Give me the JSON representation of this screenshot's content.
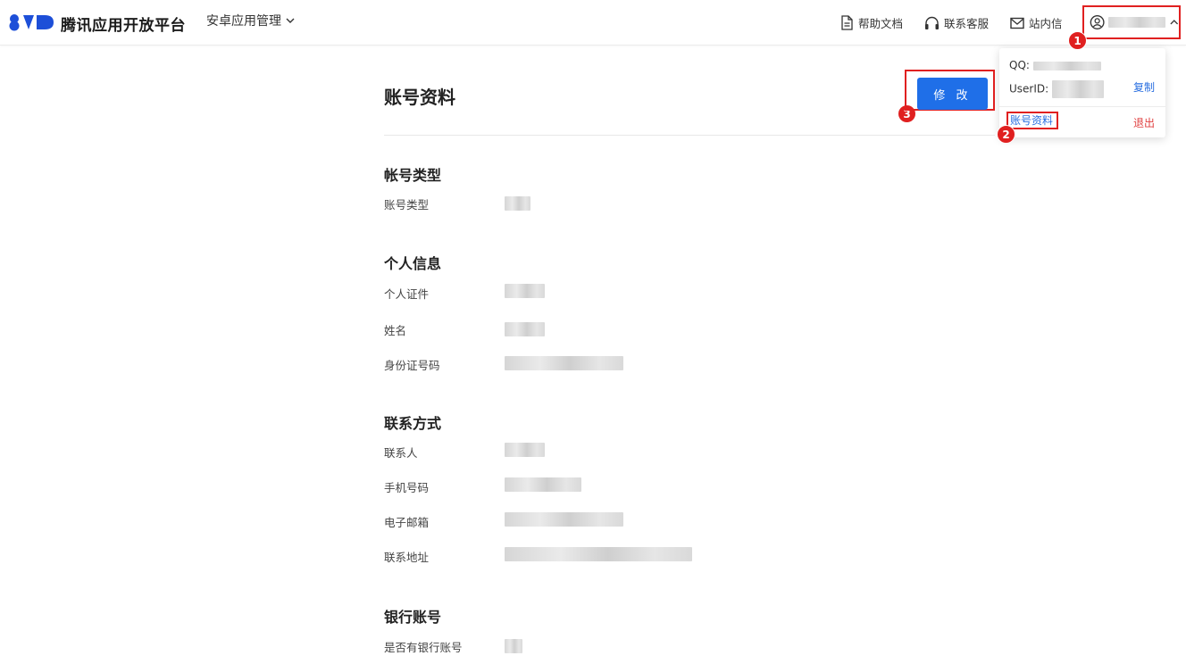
{
  "header": {
    "brand": "腾讯应用开放平台",
    "app_menu": "安卓应用管理",
    "help_docs": "帮助文档",
    "support": "联系客服",
    "inbox": "站内信"
  },
  "dropdown": {
    "qq_label": "QQ:",
    "userid_label": "UserID:",
    "copy": "复制",
    "profile": "账号资料",
    "logout": "退出"
  },
  "markers": [
    "1",
    "2",
    "3"
  ],
  "page": {
    "title": "账号资料",
    "edit_button": "修 改"
  },
  "sections": {
    "account_type": {
      "title": "帐号类型",
      "fields": [
        "账号类型"
      ]
    },
    "personal": {
      "title": "个人信息",
      "fields": [
        "个人证件",
        "姓名",
        "身份证号码"
      ]
    },
    "contact": {
      "title": "联系方式",
      "fields": [
        "联系人",
        "手机号码",
        "电子邮箱",
        "联系地址"
      ]
    },
    "bank": {
      "title": "银行账号",
      "fields": [
        "是否有银行账号"
      ]
    }
  },
  "colors": {
    "accent": "#1f6fe8",
    "annotation_red": "#e02020",
    "link": "#2a6fe0",
    "logout": "#e04040"
  }
}
